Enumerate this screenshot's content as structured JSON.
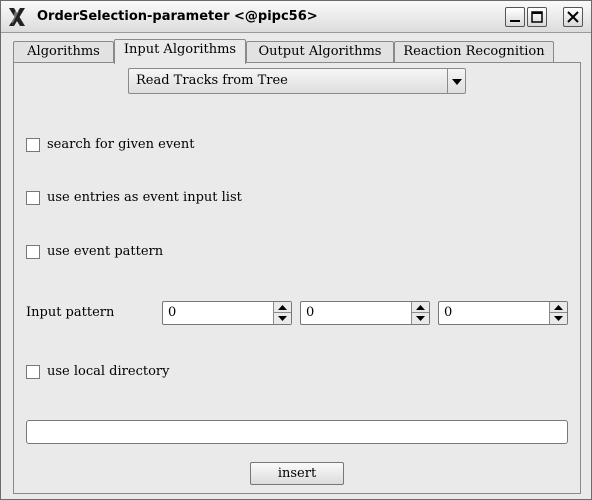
{
  "window": {
    "title": "OrderSelection-parameter <@pipc56>"
  },
  "tabs": [
    {
      "label": "Algorithms",
      "active": false
    },
    {
      "label": "Input Algorithms",
      "active": true
    },
    {
      "label": "Output Algorithms",
      "active": false
    },
    {
      "label": "Reaction Recognition",
      "active": false
    }
  ],
  "panel": {
    "combo": {
      "selected": "Read Tracks from Tree"
    },
    "checks": [
      {
        "label": "search for given event",
        "checked": false
      },
      {
        "label": "use entries as event input list",
        "checked": false
      },
      {
        "label": "use event pattern",
        "checked": false
      },
      {
        "label": "use local directory",
        "checked": false
      }
    ],
    "pattern": {
      "label": "Input pattern",
      "values": [
        "0",
        "0",
        "0"
      ]
    },
    "text_field": {
      "value": ""
    },
    "insert_label": "insert"
  },
  "icons": {
    "app": "x-logo-icon",
    "minimize": "minimize-icon",
    "maximize": "maximize-icon",
    "close": "close-icon",
    "combo_arrow": "triangle-down-icon",
    "spin_up": "triangle-up-icon",
    "spin_down": "triangle-down-icon"
  }
}
